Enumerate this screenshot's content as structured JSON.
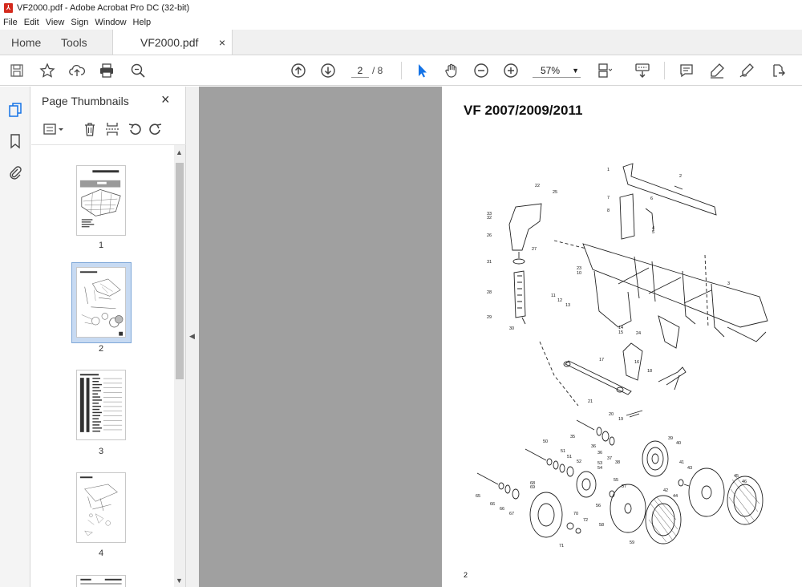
{
  "window": {
    "title": "VF2000.pdf - Adobe Acrobat Pro DC (32-bit)"
  },
  "menu": [
    "File",
    "Edit",
    "View",
    "Sign",
    "Window",
    "Help"
  ],
  "tabs": {
    "home": "Home",
    "tools": "Tools",
    "document": "VF2000.pdf",
    "close": "×"
  },
  "toolbar": {
    "current_page": "2",
    "page_total": "/ 8",
    "zoom": "57%"
  },
  "panel": {
    "title": "Page Thumbnails",
    "close": "×",
    "thumbnails": [
      {
        "label": "1",
        "selected": false
      },
      {
        "label": "2",
        "selected": true
      },
      {
        "label": "3",
        "selected": false
      },
      {
        "label": "4",
        "selected": false
      }
    ]
  },
  "page": {
    "title": "VF 2007/2009/2011",
    "number": "2",
    "callouts": [
      "1",
      "2",
      "3",
      "4",
      "5",
      "6",
      "7",
      "8",
      "10",
      "11",
      "12",
      "13",
      "14",
      "15",
      "16",
      "17",
      "18",
      "19",
      "20",
      "21",
      "22",
      "23",
      "24",
      "25",
      "26",
      "27",
      "28",
      "29",
      "30",
      "31",
      "32",
      "33",
      "35",
      "36",
      "37",
      "38",
      "39",
      "40",
      "41",
      "42",
      "43",
      "44",
      "45",
      "46",
      "50",
      "51",
      "52",
      "53",
      "54",
      "55",
      "56",
      "57",
      "58",
      "59",
      "65",
      "66",
      "67",
      "68",
      "69",
      "70",
      "71",
      "72"
    ]
  },
  "colors": {
    "accent": "#1473e6",
    "pdf_red": "#d4291c",
    "doc_bg": "#a0a0a0"
  }
}
